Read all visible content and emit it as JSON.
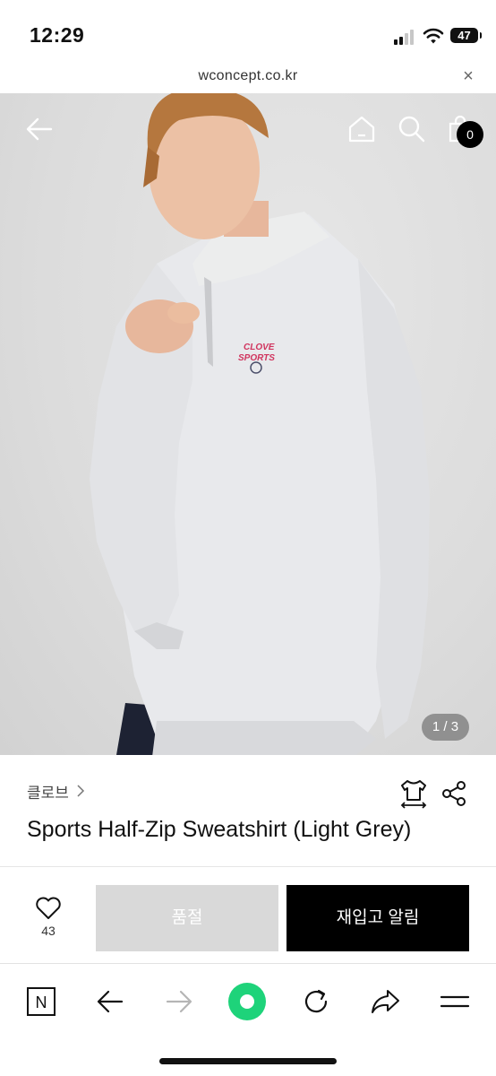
{
  "status_bar": {
    "time": "12:29",
    "battery": "47"
  },
  "url_bar": {
    "url": "wconcept.co.kr",
    "close_label": "×"
  },
  "hero": {
    "cart_count": "0",
    "pager": "1 / 3",
    "logo_line1": "CLOVE",
    "logo_line2": "SPORTS"
  },
  "product": {
    "brand": "클로브",
    "title": "Sports Half-Zip Sweatshirt (Light Grey)"
  },
  "actions": {
    "wish_count": "43",
    "soldout_label": "품절",
    "restock_label": "재입고 알림"
  },
  "toolbar": {
    "naver_label": "N"
  },
  "colors": {
    "accent_green": "#1ed37a",
    "black": "#000000",
    "disabled_grey": "#d9d9d9"
  }
}
